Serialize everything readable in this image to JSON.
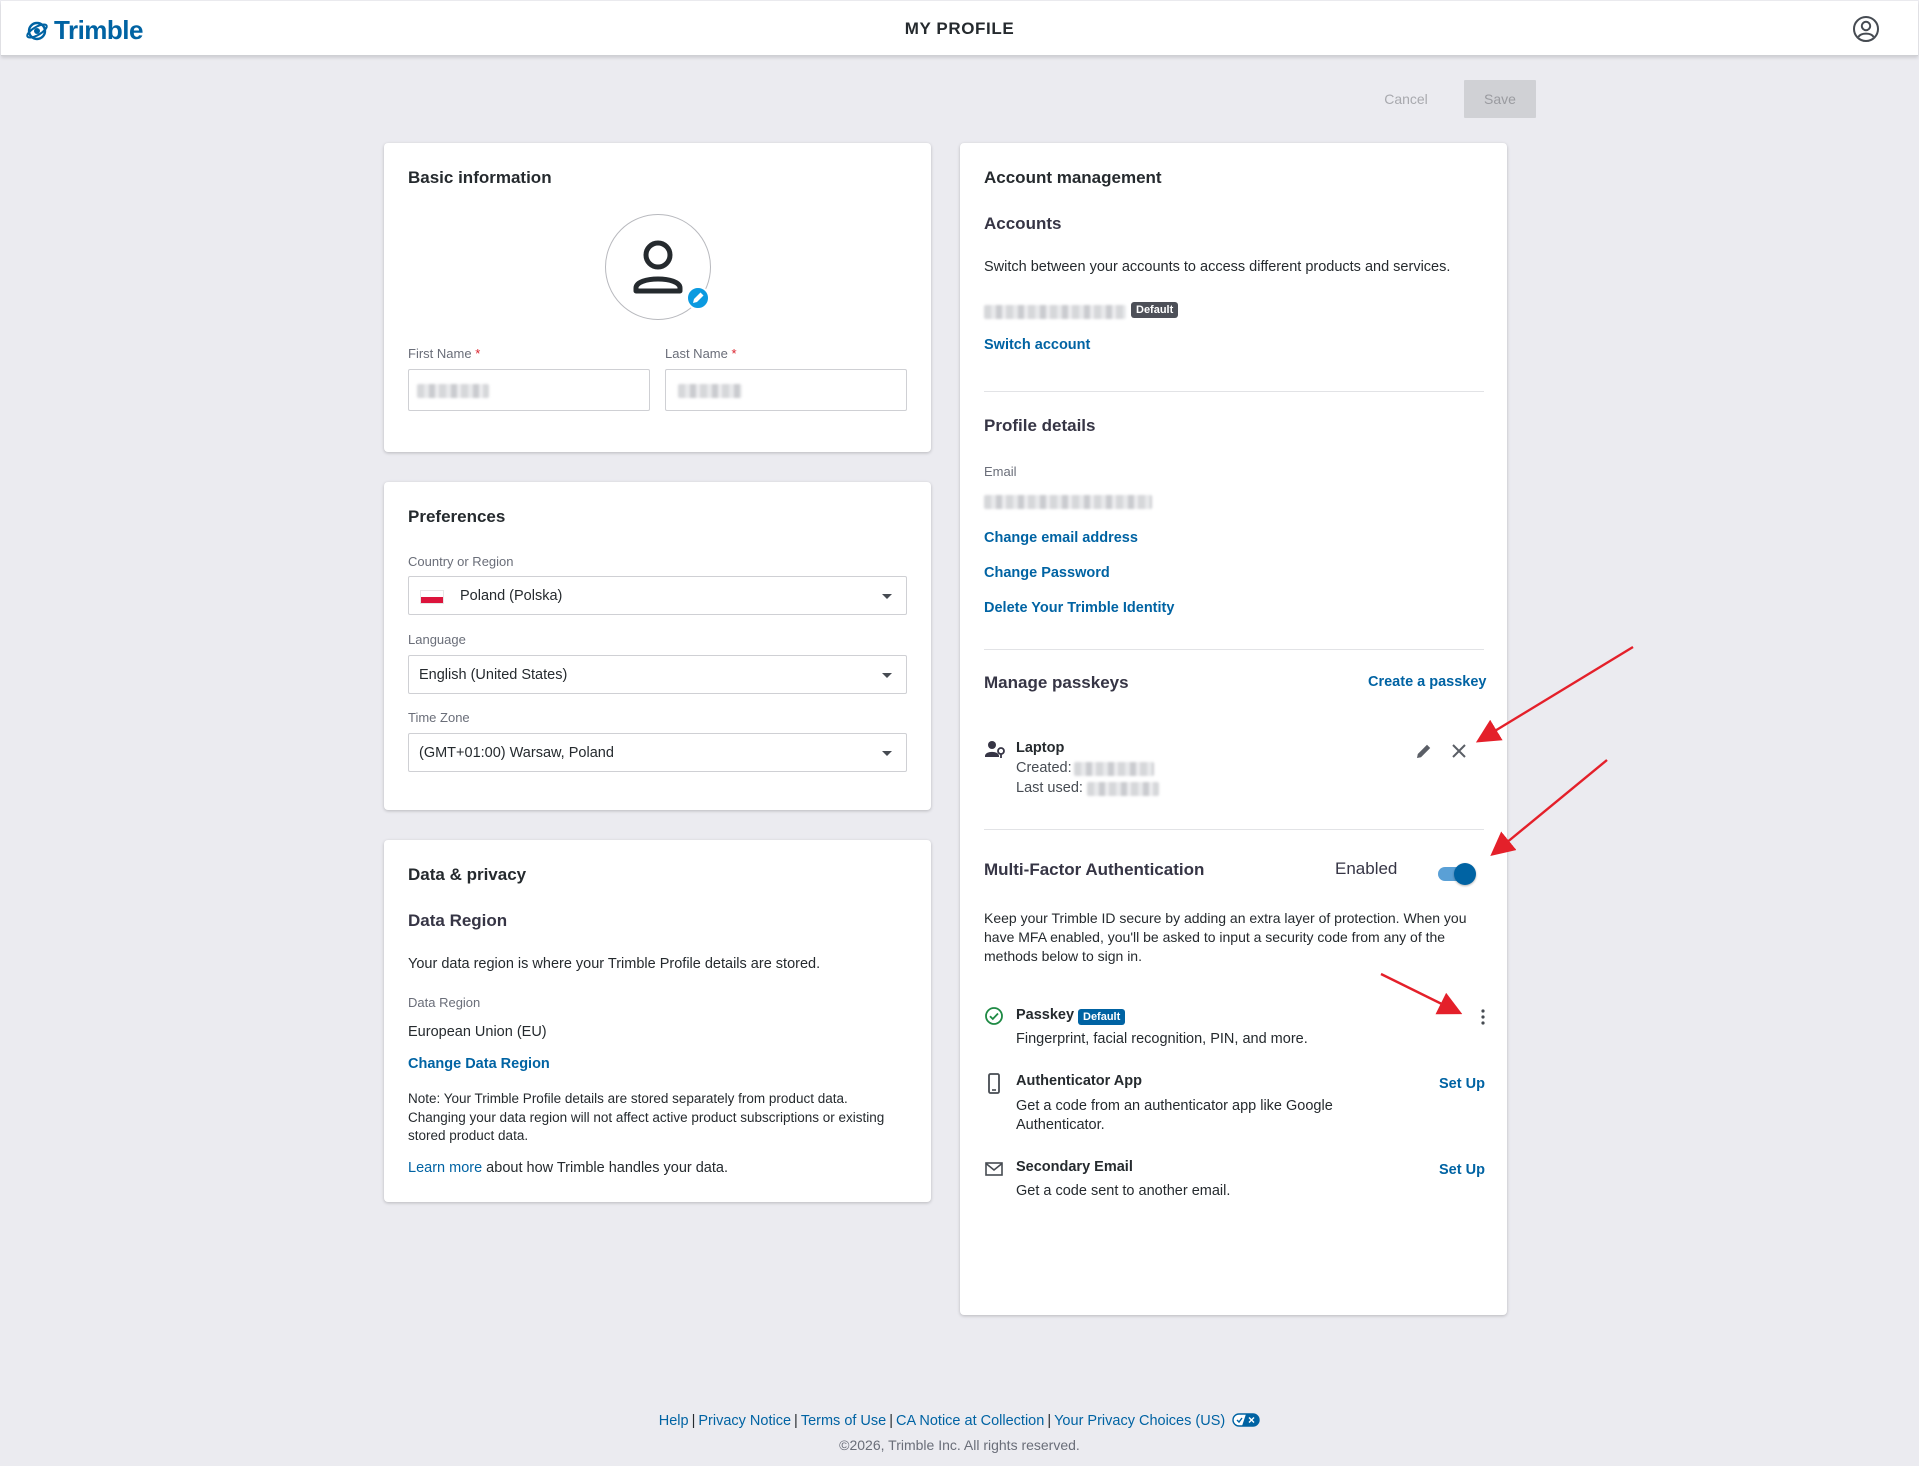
{
  "header": {
    "logo_text": "Trimble",
    "page_title": "MY PROFILE"
  },
  "actions": {
    "cancel_label": "Cancel",
    "save_label": "Save"
  },
  "basic_info": {
    "title": "Basic information",
    "first_name_label": "First Name",
    "last_name_label": "Last Name",
    "required_mark": "*"
  },
  "preferences": {
    "title": "Preferences",
    "country_label": "Country or Region",
    "country_value": "Poland (Polska)",
    "language_label": "Language",
    "language_value": "English (United States)",
    "timezone_label": "Time Zone",
    "timezone_value": "(GMT+01:00) Warsaw, Poland"
  },
  "privacy": {
    "title": "Data & privacy",
    "region_heading": "Data Region",
    "region_desc": "Your data region is where your Trimble Profile details are stored.",
    "region_label": "Data Region",
    "region_value": "European Union (EU)",
    "change_region": "Change Data Region",
    "note": "Note: Your Trimble Profile details are stored separately from product data. Changing your data region will not affect active product subscriptions or existing stored product data.",
    "learn_more": "Learn more",
    "learn_more_rest": " about how Trimble handles your data."
  },
  "account": {
    "title": "Account management",
    "accounts_heading": "Accounts",
    "accounts_desc": "Switch between your accounts to access different products and services.",
    "default_badge": "Default",
    "switch_account": "Switch account",
    "profile_heading": "Profile details",
    "email_label": "Email",
    "change_email": "Change email address",
    "change_password": "Change Password",
    "delete_identity": "Delete Your Trimble Identity",
    "passkeys_heading": "Manage passkeys",
    "create_passkey": "Create a passkey",
    "passkey_name": "Laptop",
    "created_label": "Created:",
    "last_used_label": "Last used:",
    "mfa_heading": "Multi-Factor Authentication",
    "mfa_status": "Enabled",
    "mfa_desc": "Keep your Trimble ID secure by adding an extra layer of protection. When you have MFA enabled, you'll be asked to input a security code from any of the methods below to sign in.",
    "methods": [
      {
        "name": "Passkey",
        "badge": "Default",
        "desc": "Fingerprint, facial recognition, PIN, and more."
      },
      {
        "name": "Authenticator App",
        "action": "Set Up",
        "desc": "Get a code from an authenticator app like Google Authenticator."
      },
      {
        "name": "Secondary Email",
        "action": "Set Up",
        "desc": "Get a code sent to another email."
      }
    ]
  },
  "footer": {
    "links": [
      "Help",
      "Privacy Notice",
      "Terms of Use",
      "CA Notice at Collection",
      "Your Privacy Choices (US)"
    ],
    "separator": "|",
    "copyright": "©2026, Trimble Inc. All rights reserved."
  },
  "colors": {
    "brand": "#0063a3",
    "background": "#ebebf0",
    "required": "#da212c",
    "success": "#1e8a44",
    "arrow": "#e4202a"
  }
}
